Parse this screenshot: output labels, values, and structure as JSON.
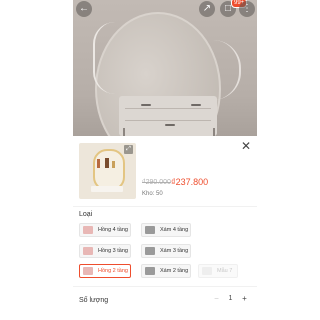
{
  "header": {
    "back_icon": "back-arrow-icon",
    "share_icon": "share-icon",
    "cart_icon": "cart-icon",
    "cart_badge": "99+",
    "more_icon": "more-icon"
  },
  "product": {
    "old_price": "₫290.000",
    "price": "₫237.800",
    "stock": "Kho: 50"
  },
  "variants": {
    "label": "Loại",
    "options": [
      {
        "label": "Hồng 4 tầng",
        "state": "normal"
      },
      {
        "label": "Xám 4 tầng",
        "state": "normal"
      },
      {
        "label": "Hồng 3 tầng",
        "state": "normal"
      },
      {
        "label": "Xám 3 tầng",
        "state": "normal"
      },
      {
        "label": "Hồng 2 tầng",
        "state": "selected"
      },
      {
        "label": "Xám 2 tầng",
        "state": "normal"
      },
      {
        "label": "Mẫu 7",
        "state": "disabled"
      }
    ]
  },
  "quantity": {
    "label": "Số lượng",
    "minus": "−",
    "value": "1",
    "plus": "+"
  },
  "colors": {
    "accent": "#ee4d2d",
    "pink": "#e8b7b5",
    "gray": "#9a9a9a"
  }
}
